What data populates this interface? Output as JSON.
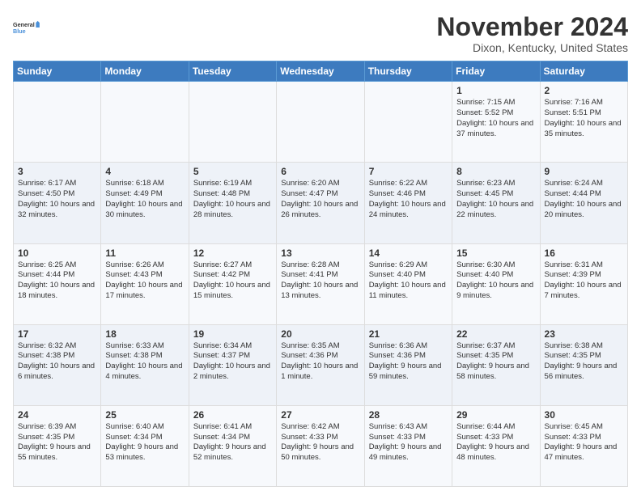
{
  "logo": {
    "line1": "General",
    "line2": "Blue"
  },
  "title": "November 2024",
  "location": "Dixon, Kentucky, United States",
  "days_header": [
    "Sunday",
    "Monday",
    "Tuesday",
    "Wednesday",
    "Thursday",
    "Friday",
    "Saturday"
  ],
  "weeks": [
    [
      {
        "day": "",
        "info": ""
      },
      {
        "day": "",
        "info": ""
      },
      {
        "day": "",
        "info": ""
      },
      {
        "day": "",
        "info": ""
      },
      {
        "day": "",
        "info": ""
      },
      {
        "day": "1",
        "info": "Sunrise: 7:15 AM\nSunset: 5:52 PM\nDaylight: 10 hours and 37 minutes."
      },
      {
        "day": "2",
        "info": "Sunrise: 7:16 AM\nSunset: 5:51 PM\nDaylight: 10 hours and 35 minutes."
      }
    ],
    [
      {
        "day": "3",
        "info": "Sunrise: 6:17 AM\nSunset: 4:50 PM\nDaylight: 10 hours and 32 minutes."
      },
      {
        "day": "4",
        "info": "Sunrise: 6:18 AM\nSunset: 4:49 PM\nDaylight: 10 hours and 30 minutes."
      },
      {
        "day": "5",
        "info": "Sunrise: 6:19 AM\nSunset: 4:48 PM\nDaylight: 10 hours and 28 minutes."
      },
      {
        "day": "6",
        "info": "Sunrise: 6:20 AM\nSunset: 4:47 PM\nDaylight: 10 hours and 26 minutes."
      },
      {
        "day": "7",
        "info": "Sunrise: 6:22 AM\nSunset: 4:46 PM\nDaylight: 10 hours and 24 minutes."
      },
      {
        "day": "8",
        "info": "Sunrise: 6:23 AM\nSunset: 4:45 PM\nDaylight: 10 hours and 22 minutes."
      },
      {
        "day": "9",
        "info": "Sunrise: 6:24 AM\nSunset: 4:44 PM\nDaylight: 10 hours and 20 minutes."
      }
    ],
    [
      {
        "day": "10",
        "info": "Sunrise: 6:25 AM\nSunset: 4:44 PM\nDaylight: 10 hours and 18 minutes."
      },
      {
        "day": "11",
        "info": "Sunrise: 6:26 AM\nSunset: 4:43 PM\nDaylight: 10 hours and 17 minutes."
      },
      {
        "day": "12",
        "info": "Sunrise: 6:27 AM\nSunset: 4:42 PM\nDaylight: 10 hours and 15 minutes."
      },
      {
        "day": "13",
        "info": "Sunrise: 6:28 AM\nSunset: 4:41 PM\nDaylight: 10 hours and 13 minutes."
      },
      {
        "day": "14",
        "info": "Sunrise: 6:29 AM\nSunset: 4:40 PM\nDaylight: 10 hours and 11 minutes."
      },
      {
        "day": "15",
        "info": "Sunrise: 6:30 AM\nSunset: 4:40 PM\nDaylight: 10 hours and 9 minutes."
      },
      {
        "day": "16",
        "info": "Sunrise: 6:31 AM\nSunset: 4:39 PM\nDaylight: 10 hours and 7 minutes."
      }
    ],
    [
      {
        "day": "17",
        "info": "Sunrise: 6:32 AM\nSunset: 4:38 PM\nDaylight: 10 hours and 6 minutes."
      },
      {
        "day": "18",
        "info": "Sunrise: 6:33 AM\nSunset: 4:38 PM\nDaylight: 10 hours and 4 minutes."
      },
      {
        "day": "19",
        "info": "Sunrise: 6:34 AM\nSunset: 4:37 PM\nDaylight: 10 hours and 2 minutes."
      },
      {
        "day": "20",
        "info": "Sunrise: 6:35 AM\nSunset: 4:36 PM\nDaylight: 10 hours and 1 minute."
      },
      {
        "day": "21",
        "info": "Sunrise: 6:36 AM\nSunset: 4:36 PM\nDaylight: 9 hours and 59 minutes."
      },
      {
        "day": "22",
        "info": "Sunrise: 6:37 AM\nSunset: 4:35 PM\nDaylight: 9 hours and 58 minutes."
      },
      {
        "day": "23",
        "info": "Sunrise: 6:38 AM\nSunset: 4:35 PM\nDaylight: 9 hours and 56 minutes."
      }
    ],
    [
      {
        "day": "24",
        "info": "Sunrise: 6:39 AM\nSunset: 4:35 PM\nDaylight: 9 hours and 55 minutes."
      },
      {
        "day": "25",
        "info": "Sunrise: 6:40 AM\nSunset: 4:34 PM\nDaylight: 9 hours and 53 minutes."
      },
      {
        "day": "26",
        "info": "Sunrise: 6:41 AM\nSunset: 4:34 PM\nDaylight: 9 hours and 52 minutes."
      },
      {
        "day": "27",
        "info": "Sunrise: 6:42 AM\nSunset: 4:33 PM\nDaylight: 9 hours and 50 minutes."
      },
      {
        "day": "28",
        "info": "Sunrise: 6:43 AM\nSunset: 4:33 PM\nDaylight: 9 hours and 49 minutes."
      },
      {
        "day": "29",
        "info": "Sunrise: 6:44 AM\nSunset: 4:33 PM\nDaylight: 9 hours and 48 minutes."
      },
      {
        "day": "30",
        "info": "Sunrise: 6:45 AM\nSunset: 4:33 PM\nDaylight: 9 hours and 47 minutes."
      }
    ]
  ]
}
